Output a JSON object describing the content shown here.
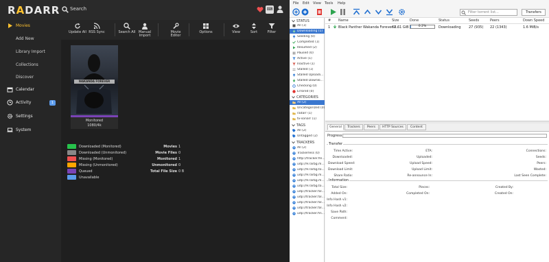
{
  "radarr": {
    "logo": {
      "pre": "R",
      "accent": "A",
      "post": "DARR"
    },
    "search_label": "Search",
    "kbd_label": "⌨",
    "nav": [
      {
        "label": "Movies",
        "icon": "play-icon"
      },
      {
        "label": "Add New"
      },
      {
        "label": "Library Import"
      },
      {
        "label": "Collections"
      },
      {
        "label": "Discover"
      },
      {
        "label": "Calendar",
        "icon": "calendar-icon"
      },
      {
        "label": "Activity",
        "icon": "clock-icon",
        "badge": "1"
      },
      {
        "label": "Settings",
        "icon": "gear-icon"
      },
      {
        "label": "System",
        "icon": "laptop-icon"
      }
    ],
    "toolbar": {
      "update_all": "Update All",
      "rss_sync": "RSS Sync",
      "search_all": "Search All",
      "manual_import": "Manual Import",
      "movie_editor": "Movie Editor",
      "options": "Options",
      "view": "View",
      "sort": "Sort",
      "filter": "Filter"
    },
    "poster": {
      "title_art": "WAKANDA FOREVER",
      "status": "Monitored",
      "quality": "1080/4k"
    },
    "legend": [
      {
        "label": "Downloaded (Monitored)",
        "color": "#27c24c"
      },
      {
        "label": "Downloaded (Unmonitored)",
        "color": "#888888"
      },
      {
        "label": "Missing (Monitored)",
        "color": "#f05050"
      },
      {
        "label": "Missing (Unmonitored)",
        "color": "#ffa500"
      },
      {
        "label": "Queued",
        "color": "#7a43b6"
      },
      {
        "label": "Unavailable",
        "color": "#5d9cec"
      }
    ],
    "stats": [
      {
        "k": "Movies",
        "v": "1"
      },
      {
        "k": "Movie Files",
        "v": "0"
      },
      {
        "k": "Monitored",
        "v": "1"
      },
      {
        "k": "Unmonitored",
        "v": "0"
      },
      {
        "k": "Total File Size",
        "v": "0 B"
      }
    ],
    "accent": "#ffc230"
  },
  "qbt": {
    "menu": [
      "File",
      "Edit",
      "View",
      "Tools",
      "Help"
    ],
    "filter_placeholder": "Filter torrent list...",
    "transfers_btn": "Transfers",
    "status_header": "STATUS",
    "status": [
      {
        "label": "All (1)"
      },
      {
        "label": "Downloading (1)",
        "selected": true
      },
      {
        "label": "Seeding (0)"
      },
      {
        "label": "Completed (1)"
      },
      {
        "label": "Resumed (2)"
      },
      {
        "label": "Paused (0)"
      },
      {
        "label": "Active (1)"
      },
      {
        "label": "Inactive (1)"
      },
      {
        "label": "Stalled (1)"
      },
      {
        "label": "Stalled Uploadi..."
      },
      {
        "label": "Stalled Downlo..."
      },
      {
        "label": "Checking (0)"
      },
      {
        "label": "Errored (0)"
      }
    ],
    "categories_header": "CATEGORIES",
    "categories": [
      {
        "label": "All (2)",
        "selected": true
      },
      {
        "label": "Uncategorized (0)"
      },
      {
        "label": "radarr (1)"
      },
      {
        "label": "tv-sonarr (1)"
      }
    ],
    "tags_header": "TAGS",
    "tags": [
      {
        "label": "All (2)"
      },
      {
        "label": "Untagged (2)"
      }
    ],
    "trackers_header": "TRACKERS",
    "trackers": [
      {
        "label": "All (2)"
      },
      {
        "label": "Trackerless (0)"
      },
      {
        "label": "http://tracker.fin..."
      },
      {
        "label": "udp://9.rarbg.m..."
      },
      {
        "label": "udp://9.rarbg.to..."
      },
      {
        "label": "udp://9.rarbg.m..."
      },
      {
        "label": "udp://9.rarbg.m..."
      },
      {
        "label": "udp://9.rarbg.to..."
      },
      {
        "label": "udp://tracker.fal..."
      },
      {
        "label": "udp://tracker.fal..."
      },
      {
        "label": "udp://tracker.fal..."
      },
      {
        "label": "udp://tracker.fal..."
      },
      {
        "label": "udp://tracker.fin..."
      }
    ],
    "columns": [
      "#",
      "Name",
      "Size",
      "Done",
      "Status",
      "Seeds",
      "Peers",
      "Down Speed"
    ],
    "torrent": {
      "num": "1",
      "name": "Black Panther Wakanda Forever 2...",
      "size": "60.61 GiB",
      "done": "0.2%",
      "progress": 0.002,
      "status": "Downloading",
      "seeds": "27 (935)",
      "peers": "22 (1343)",
      "down_speed": "1.6 MiB/s"
    },
    "tabs": [
      "General",
      "Trackers",
      "Peers",
      "HTTP Sources",
      "Content"
    ],
    "progress_label": "Progress:",
    "transfer_title": "Transfer",
    "transfer": {
      "time_active": "Time Active:",
      "eta": "ETA:",
      "connections": "Connections:",
      "downloaded": "Downloaded:",
      "uploaded": "Uploaded:",
      "seeds": "Seeds:",
      "download_speed": "Download Speed:",
      "upload_speed": "Upload Speed:",
      "peers": "Peers:",
      "download_limit": "Download Limit:",
      "upload_limit": "Upload Limit:",
      "wasted": "Wasted:",
      "share_ratio": "Share Ratio:",
      "reannounce": "Re-announce In:",
      "last_seen": "Last Seen Complete:"
    },
    "info_title": "Information",
    "info": {
      "total_size": "Total Size:",
      "pieces": "Pieces:",
      "created_by": "Created By:",
      "added_on": "Added On:",
      "completed_on": "Completed On:",
      "created_on": "Created On:",
      "hash_v1": "Info Hash v1:",
      "hash_v2": "Info Hash v2:",
      "save_path": "Save Path:",
      "comment": "Comment:"
    }
  }
}
